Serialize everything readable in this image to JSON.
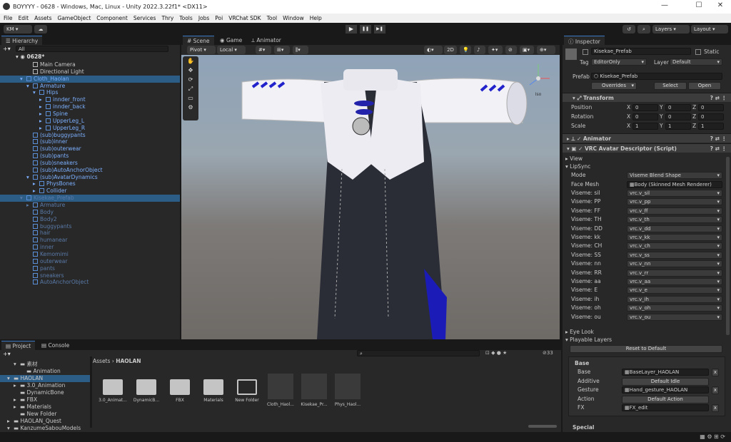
{
  "window": {
    "title": "BOYYYY - 0628 - Windows, Mac, Linux - Unity 2022.3.22f1* <DX11>",
    "min": "—",
    "max": "☐",
    "close": "✕"
  },
  "menu": [
    "File",
    "Edit",
    "Assets",
    "GameObject",
    "Component",
    "Services",
    "Thry",
    "Tools",
    "Jobs",
    "Poi",
    "VRChat SDK",
    "Tool",
    "Window",
    "Help"
  ],
  "toolbar": {
    "account": "KM ▾",
    "play": "▶",
    "pause": "❚❚",
    "step": "▶❚",
    "layers": "Layers",
    "layout": "Layout"
  },
  "hierarchy": {
    "tab": "Hierarchy",
    "search": "All",
    "scene": "0628*",
    "rows": [
      {
        "label": "Main Camera",
        "indent": 3,
        "style": "normal",
        "arrow": ""
      },
      {
        "label": "Directional Light",
        "indent": 3,
        "style": "normal",
        "arrow": ""
      },
      {
        "label": "Cloth_Haolan",
        "indent": 2,
        "style": "blue-sel",
        "arrow": "▾"
      },
      {
        "label": "Armature",
        "indent": 3,
        "style": "blue",
        "arrow": "▾"
      },
      {
        "label": "Hips",
        "indent": 4,
        "style": "blue",
        "arrow": "▾"
      },
      {
        "label": "innder_front",
        "indent": 5,
        "style": "blue",
        "arrow": "▸"
      },
      {
        "label": "innder_back",
        "indent": 5,
        "style": "blue",
        "arrow": "▸"
      },
      {
        "label": "Spine",
        "indent": 5,
        "style": "blue",
        "arrow": "▸"
      },
      {
        "label": "UpperLeg_L",
        "indent": 5,
        "style": "blue",
        "arrow": "▸"
      },
      {
        "label": "UpperLeg_R",
        "indent": 5,
        "style": "blue",
        "arrow": "▸"
      },
      {
        "label": "(sub)buggypants",
        "indent": 3,
        "style": "blue",
        "arrow": ""
      },
      {
        "label": "(sub)inner",
        "indent": 3,
        "style": "blue",
        "arrow": ""
      },
      {
        "label": "(sub)outerwear",
        "indent": 3,
        "style": "blue",
        "arrow": ""
      },
      {
        "label": "(sub)pants",
        "indent": 3,
        "style": "blue",
        "arrow": ""
      },
      {
        "label": "(sub)sneakers",
        "indent": 3,
        "style": "blue",
        "arrow": ""
      },
      {
        "label": "(sub)AutoAnchorObject",
        "indent": 3,
        "style": "blue",
        "arrow": ""
      },
      {
        "label": "(sub)AvatarDynamics",
        "indent": 3,
        "style": "blue",
        "arrow": "▾"
      },
      {
        "label": "PhysBones",
        "indent": 4,
        "style": "blue",
        "arrow": "▸"
      },
      {
        "label": "Collider",
        "indent": 4,
        "style": "blue",
        "arrow": "▸"
      },
      {
        "label": "Kisekae_Prefab",
        "indent": 2,
        "style": "dim-sel",
        "arrow": "▾"
      },
      {
        "label": "Armature",
        "indent": 3,
        "style": "dim",
        "arrow": "▸"
      },
      {
        "label": "Body",
        "indent": 3,
        "style": "dim",
        "arrow": ""
      },
      {
        "label": "Body2",
        "indent": 3,
        "style": "dim",
        "arrow": ""
      },
      {
        "label": "buggypants",
        "indent": 3,
        "style": "dim",
        "arrow": ""
      },
      {
        "label": "hair",
        "indent": 3,
        "style": "dim",
        "arrow": ""
      },
      {
        "label": "humanear",
        "indent": 3,
        "style": "dim",
        "arrow": ""
      },
      {
        "label": "inner",
        "indent": 3,
        "style": "dim",
        "arrow": ""
      },
      {
        "label": "Kemomimi",
        "indent": 3,
        "style": "dim",
        "arrow": ""
      },
      {
        "label": "outerwear",
        "indent": 3,
        "style": "dim",
        "arrow": ""
      },
      {
        "label": "pants",
        "indent": 3,
        "style": "dim",
        "arrow": ""
      },
      {
        "label": "sneakers",
        "indent": 3,
        "style": "dim",
        "arrow": ""
      },
      {
        "label": "AutoAnchorObject",
        "indent": 3,
        "style": "dim",
        "arrow": ""
      }
    ]
  },
  "scene": {
    "tabs": [
      "Scene",
      "Game",
      "Animator"
    ],
    "pivot": "Pivot",
    "local": "Local",
    "mode2d": "2D",
    "persp": "Iso"
  },
  "inspector": {
    "tab": "Inspector",
    "name": "Kisekae_Prefab",
    "static": "Static",
    "tag_label": "Tag",
    "tag": "EditorOnly",
    "layer_label": "Layer",
    "layer": "Default",
    "prefab_label": "Prefab",
    "prefab": "Kisekae_Prefab",
    "overrides": "Overrides",
    "select": "Select",
    "open": "Open",
    "transform": {
      "title": "Transform",
      "position": "Position",
      "rotation": "Rotation",
      "scale": "Scale",
      "pos": [
        "0",
        "0",
        "0"
      ],
      "rot": [
        "0",
        "0",
        "0"
      ],
      "scl": [
        "1",
        "1",
        "1"
      ]
    },
    "animator": "Animator",
    "vrc": "VRC Avatar Descriptor (Script)",
    "view": "View",
    "lipsync": "LipSync",
    "mode_label": "Mode",
    "mode": "Viseme Blend Shape",
    "face_label": "Face Mesh",
    "face": "Body (Skinned Mesh Renderer)",
    "visemes": [
      {
        "label": "Viseme: sil",
        "value": "vrc.v_sil"
      },
      {
        "label": "Viseme: PP",
        "value": "vrc.v_pp"
      },
      {
        "label": "Viseme: FF",
        "value": "vrc.v_ff"
      },
      {
        "label": "Viseme: TH",
        "value": "vrc.v_th"
      },
      {
        "label": "Viseme: DD",
        "value": "vrc.v_dd"
      },
      {
        "label": "Viseme: kk",
        "value": "vrc.v_kk"
      },
      {
        "label": "Viseme: CH",
        "value": "vrc.v_ch"
      },
      {
        "label": "Viseme: SS",
        "value": "vrc.v_ss"
      },
      {
        "label": "Viseme: nn",
        "value": "vrc.v_nn"
      },
      {
        "label": "Viseme: RR",
        "value": "vrc.v_rr"
      },
      {
        "label": "Viseme: aa",
        "value": "vrc.v_aa"
      },
      {
        "label": "Viseme: E",
        "value": "vrc.v_e"
      },
      {
        "label": "Viseme: ih",
        "value": "vrc.v_ih"
      },
      {
        "label": "Viseme: oh",
        "value": "vrc.v_oh"
      },
      {
        "label": "Viseme: ou",
        "value": "vrc.v_ou"
      }
    ],
    "eyelook": "Eye Look",
    "playable": "Playable Layers",
    "reset": "Reset to Default",
    "base": "Base",
    "layers": [
      {
        "label": "Base",
        "value": "BaseLayer_HAOLAN",
        "type": "field"
      },
      {
        "label": "Additive",
        "value": "Default Idle",
        "type": "button"
      },
      {
        "label": "Gesture",
        "value": "Hand_gesture_HAOLAN",
        "type": "field"
      },
      {
        "label": "Action",
        "value": "Default Action",
        "type": "button"
      },
      {
        "label": "FX",
        "value": "FX_edit",
        "type": "field"
      }
    ],
    "special": "Special"
  },
  "project": {
    "tabs": [
      "Project",
      "Console"
    ],
    "tree": [
      {
        "label": "素材",
        "indent": 1,
        "arrow": "▾"
      },
      {
        "label": "Animation",
        "indent": 2,
        "arrow": ""
      },
      {
        "label": "HAOLAN",
        "indent": 0,
        "arrow": "▾"
      },
      {
        "label": "3.0_Animation",
        "indent": 1,
        "arrow": "▸"
      },
      {
        "label": "DynamicBone",
        "indent": 1,
        "arrow": ""
      },
      {
        "label": "FBX",
        "indent": 1,
        "arrow": "▸"
      },
      {
        "label": "Materials",
        "indent": 1,
        "arrow": "▸"
      },
      {
        "label": "New Folder",
        "indent": 1,
        "arrow": ""
      },
      {
        "label": "HAOLAN_Quest",
        "indent": 0,
        "arrow": "▸"
      },
      {
        "label": "KanzumeSabouModels",
        "indent": 0,
        "arrow": "▾"
      }
    ],
    "breadcrumb_root": "Assets",
    "breadcrumb_sep": "›",
    "breadcrumb_leaf": "HAOLAN",
    "hidden_count": "33",
    "assets": [
      {
        "label": "3.0_Animat...",
        "kind": "folder"
      },
      {
        "label": "DynamicB...",
        "kind": "folder"
      },
      {
        "label": "FBX",
        "kind": "folder"
      },
      {
        "label": "Materials",
        "kind": "folder"
      },
      {
        "label": "New Folder",
        "kind": "folder-empty"
      },
      {
        "label": "Cloth_Haol...",
        "kind": "prefab"
      },
      {
        "label": "Kisekae_Pr...",
        "kind": "prefab"
      },
      {
        "label": "Phys_Haol...",
        "kind": "prefab"
      }
    ]
  },
  "colors": {
    "accent": "#3a78c4",
    "blue_text": "#7cb0ff",
    "panel": "#282828",
    "dark": "#191919"
  }
}
